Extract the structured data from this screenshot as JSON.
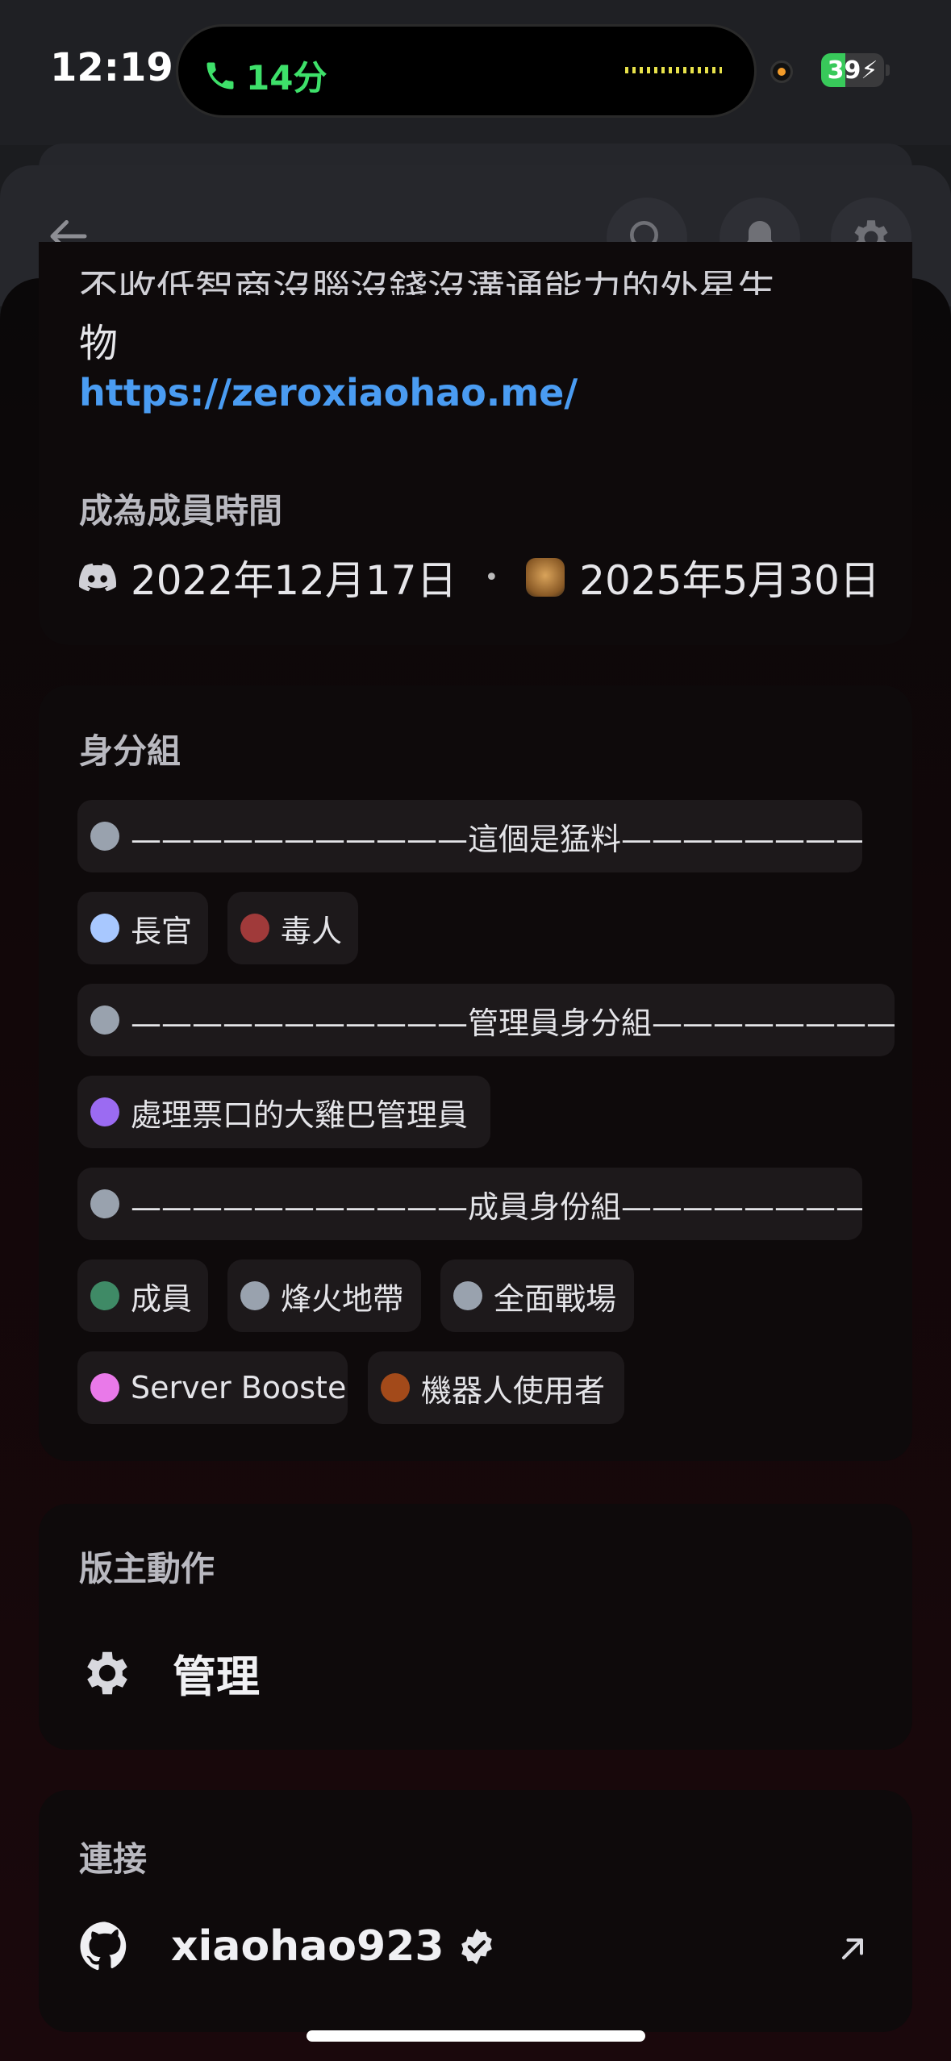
{
  "status_bar": {
    "time": "12:19",
    "call_duration": "14分",
    "battery_level": "39"
  },
  "profile": {
    "bio_line1": "不收低智商沒腦沒錢沒溝通能力的外星生",
    "bio_line2": "物",
    "website": "https://zeroxiaohao.me/",
    "member_since_title": "成為成員時間",
    "discord_joined": "2022年12月17日",
    "separator": "•",
    "server_joined": "2025年5月30日"
  },
  "roles": {
    "title": "身分組",
    "items": [
      {
        "label": "———————————這個是猛料———————————",
        "color": "#99a2ae"
      },
      {
        "label": "長官",
        "color": "#a8c8ff"
      },
      {
        "label": "毒人",
        "color": "#a03a3a"
      },
      {
        "label": "———————————管理員身分組———————————",
        "color": "#99a2ae"
      },
      {
        "label": "處理票口的大雞巴管理員",
        "color": "#9b6bf2"
      },
      {
        "label": "———————————成員身份組———————————",
        "color": "#99a2ae"
      },
      {
        "label": "成員",
        "color": "#3f8a66"
      },
      {
        "label": "烽火地帶",
        "color": "#99a2ae"
      },
      {
        "label": "全面戰場",
        "color": "#99a2ae"
      },
      {
        "label": "Server Booster",
        "color": "#e979e9"
      },
      {
        "label": "機器人使用者",
        "color": "#a34a1a"
      }
    ]
  },
  "moderator": {
    "title": "版主動作",
    "manage_label": "管理"
  },
  "connections": {
    "title": "連接",
    "github_username": "xiaohao923"
  },
  "icons": {
    "back": "arrow-left-icon",
    "search": "search-icon",
    "notifications": "bell-icon",
    "settings": "gear-icon",
    "github": "github-icon",
    "verified": "verified-icon",
    "external": "external-link-icon"
  }
}
